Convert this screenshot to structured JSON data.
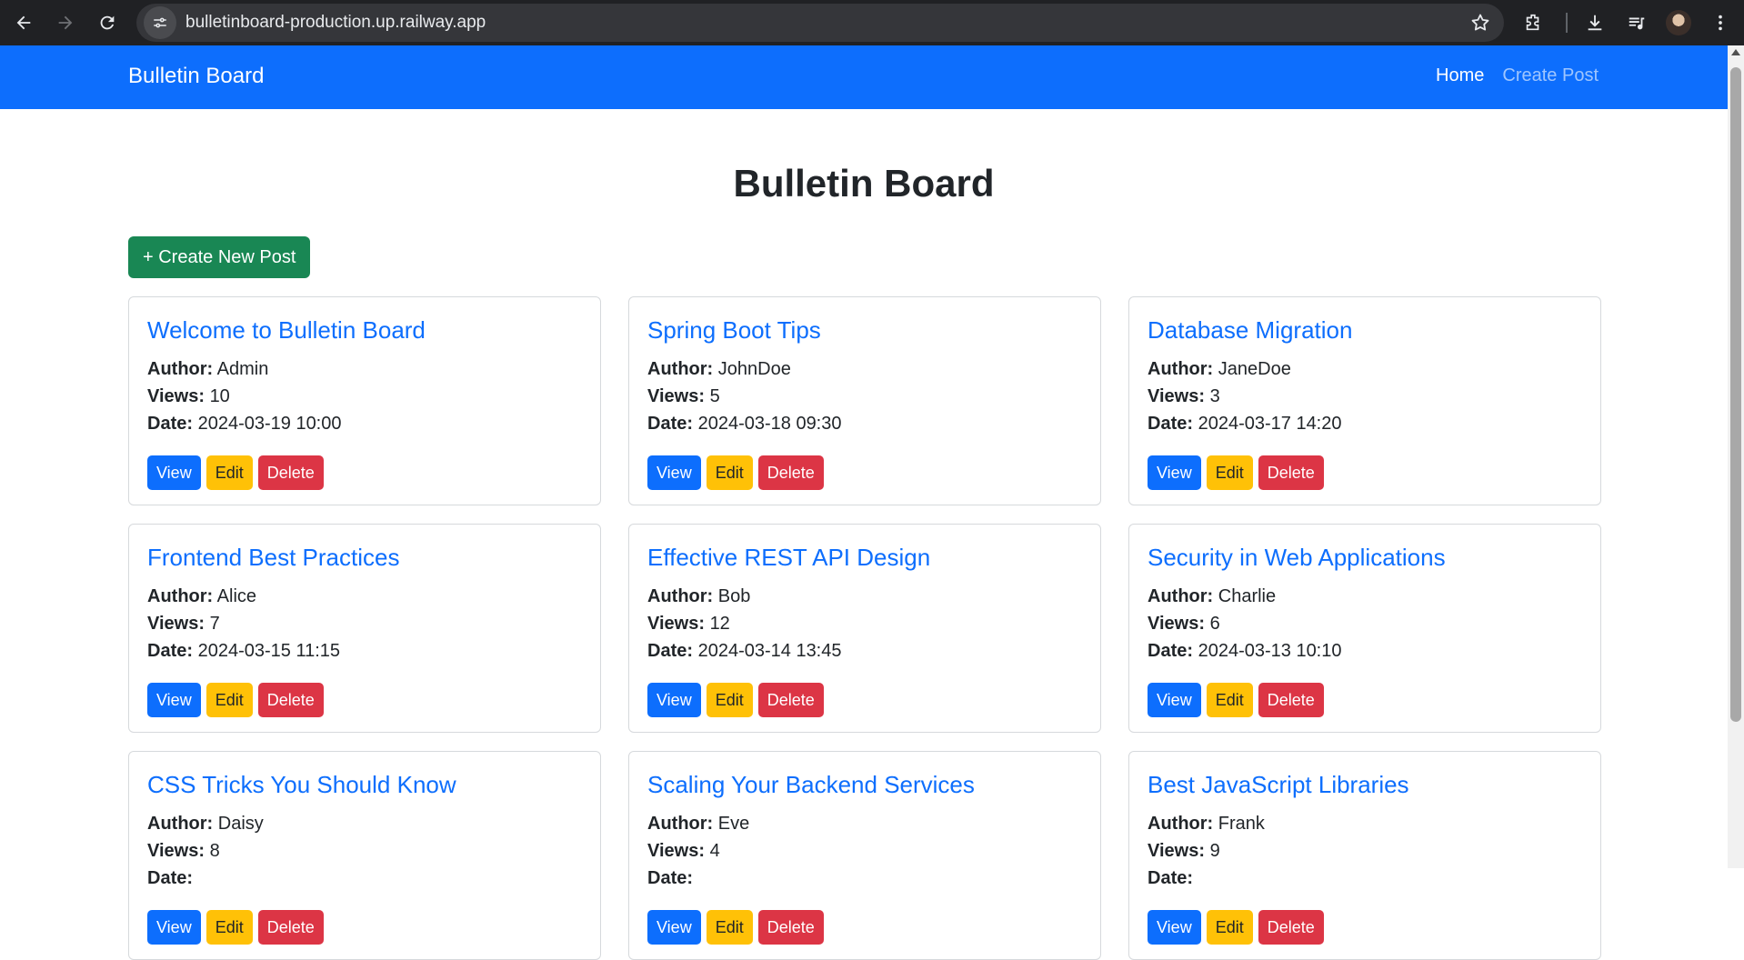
{
  "browser": {
    "url": "bulletinboard-production.up.railway.app"
  },
  "navbar": {
    "brand": "Bulletin Board",
    "links": {
      "home": "Home",
      "create": "Create Post"
    }
  },
  "main": {
    "title": "Bulletin Board",
    "create_button": "+ Create New Post",
    "labels": {
      "author": "Author:",
      "views": "Views:",
      "date": "Date:"
    },
    "actions": {
      "view": "View",
      "edit": "Edit",
      "delete": "Delete"
    },
    "posts": [
      {
        "title": "Welcome to Bulletin Board",
        "author": "Admin",
        "views": "10",
        "date": "2024-03-19 10:00"
      },
      {
        "title": "Spring Boot Tips",
        "author": "JohnDoe",
        "views": "5",
        "date": "2024-03-18 09:30"
      },
      {
        "title": "Database Migration",
        "author": "JaneDoe",
        "views": "3",
        "date": "2024-03-17 14:20"
      },
      {
        "title": "Frontend Best Practices",
        "author": "Alice",
        "views": "7",
        "date": "2024-03-15 11:15"
      },
      {
        "title": "Effective REST API Design",
        "author": "Bob",
        "views": "12",
        "date": "2024-03-14 13:45"
      },
      {
        "title": "Security in Web Applications",
        "author": "Charlie",
        "views": "6",
        "date": "2024-03-13 10:10"
      },
      {
        "title": "CSS Tricks You Should Know",
        "author": "Daisy",
        "views": "8",
        "date": ""
      },
      {
        "title": "Scaling Your Backend Services",
        "author": "Eve",
        "views": "4",
        "date": ""
      },
      {
        "title": "Best JavaScript Libraries",
        "author": "Frank",
        "views": "9",
        "date": ""
      }
    ]
  },
  "colors": {
    "primary": "#0d6efd",
    "success": "#198754",
    "warning": "#ffc107",
    "danger": "#dc3545"
  }
}
